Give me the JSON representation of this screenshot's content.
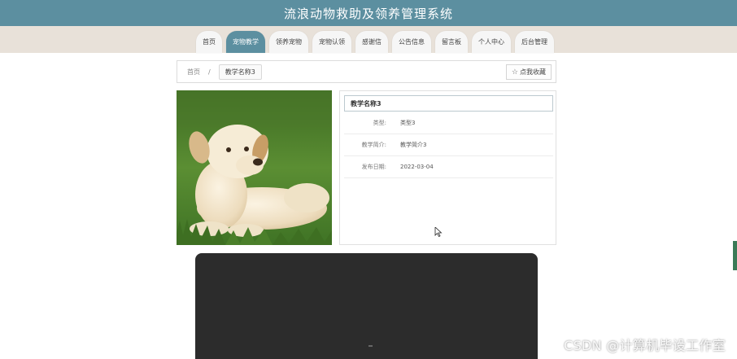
{
  "header": {
    "title": "流浪动物救助及领养管理系统"
  },
  "nav": {
    "items": [
      {
        "label": "首页",
        "active": false
      },
      {
        "label": "宠物教学",
        "active": true
      },
      {
        "label": "领养宠物",
        "active": false
      },
      {
        "label": "宠物认领",
        "active": false
      },
      {
        "label": "感谢信",
        "active": false
      },
      {
        "label": "公告信息",
        "active": false
      },
      {
        "label": "留言板",
        "active": false
      },
      {
        "label": "个人中心",
        "active": false
      },
      {
        "label": "后台管理",
        "active": false
      }
    ]
  },
  "breadcrumb": {
    "home": "首页",
    "separator": "/",
    "current": "教学名称3"
  },
  "favorite_button": {
    "icon": "☆",
    "label": "点我收藏"
  },
  "detail": {
    "title": "教学名称3",
    "rows": [
      {
        "label": "类型:",
        "value": "类型3"
      },
      {
        "label": "教学简介:",
        "value": "教学简介3"
      },
      {
        "label": "发布日期:",
        "value": "2022-03-04"
      }
    ]
  },
  "watermark": "CSDN @计算机毕设工作室",
  "colors": {
    "accent": "#5c8fa0",
    "nav_band": "#e8e1d9",
    "video_bg": "#2c2c2c"
  }
}
